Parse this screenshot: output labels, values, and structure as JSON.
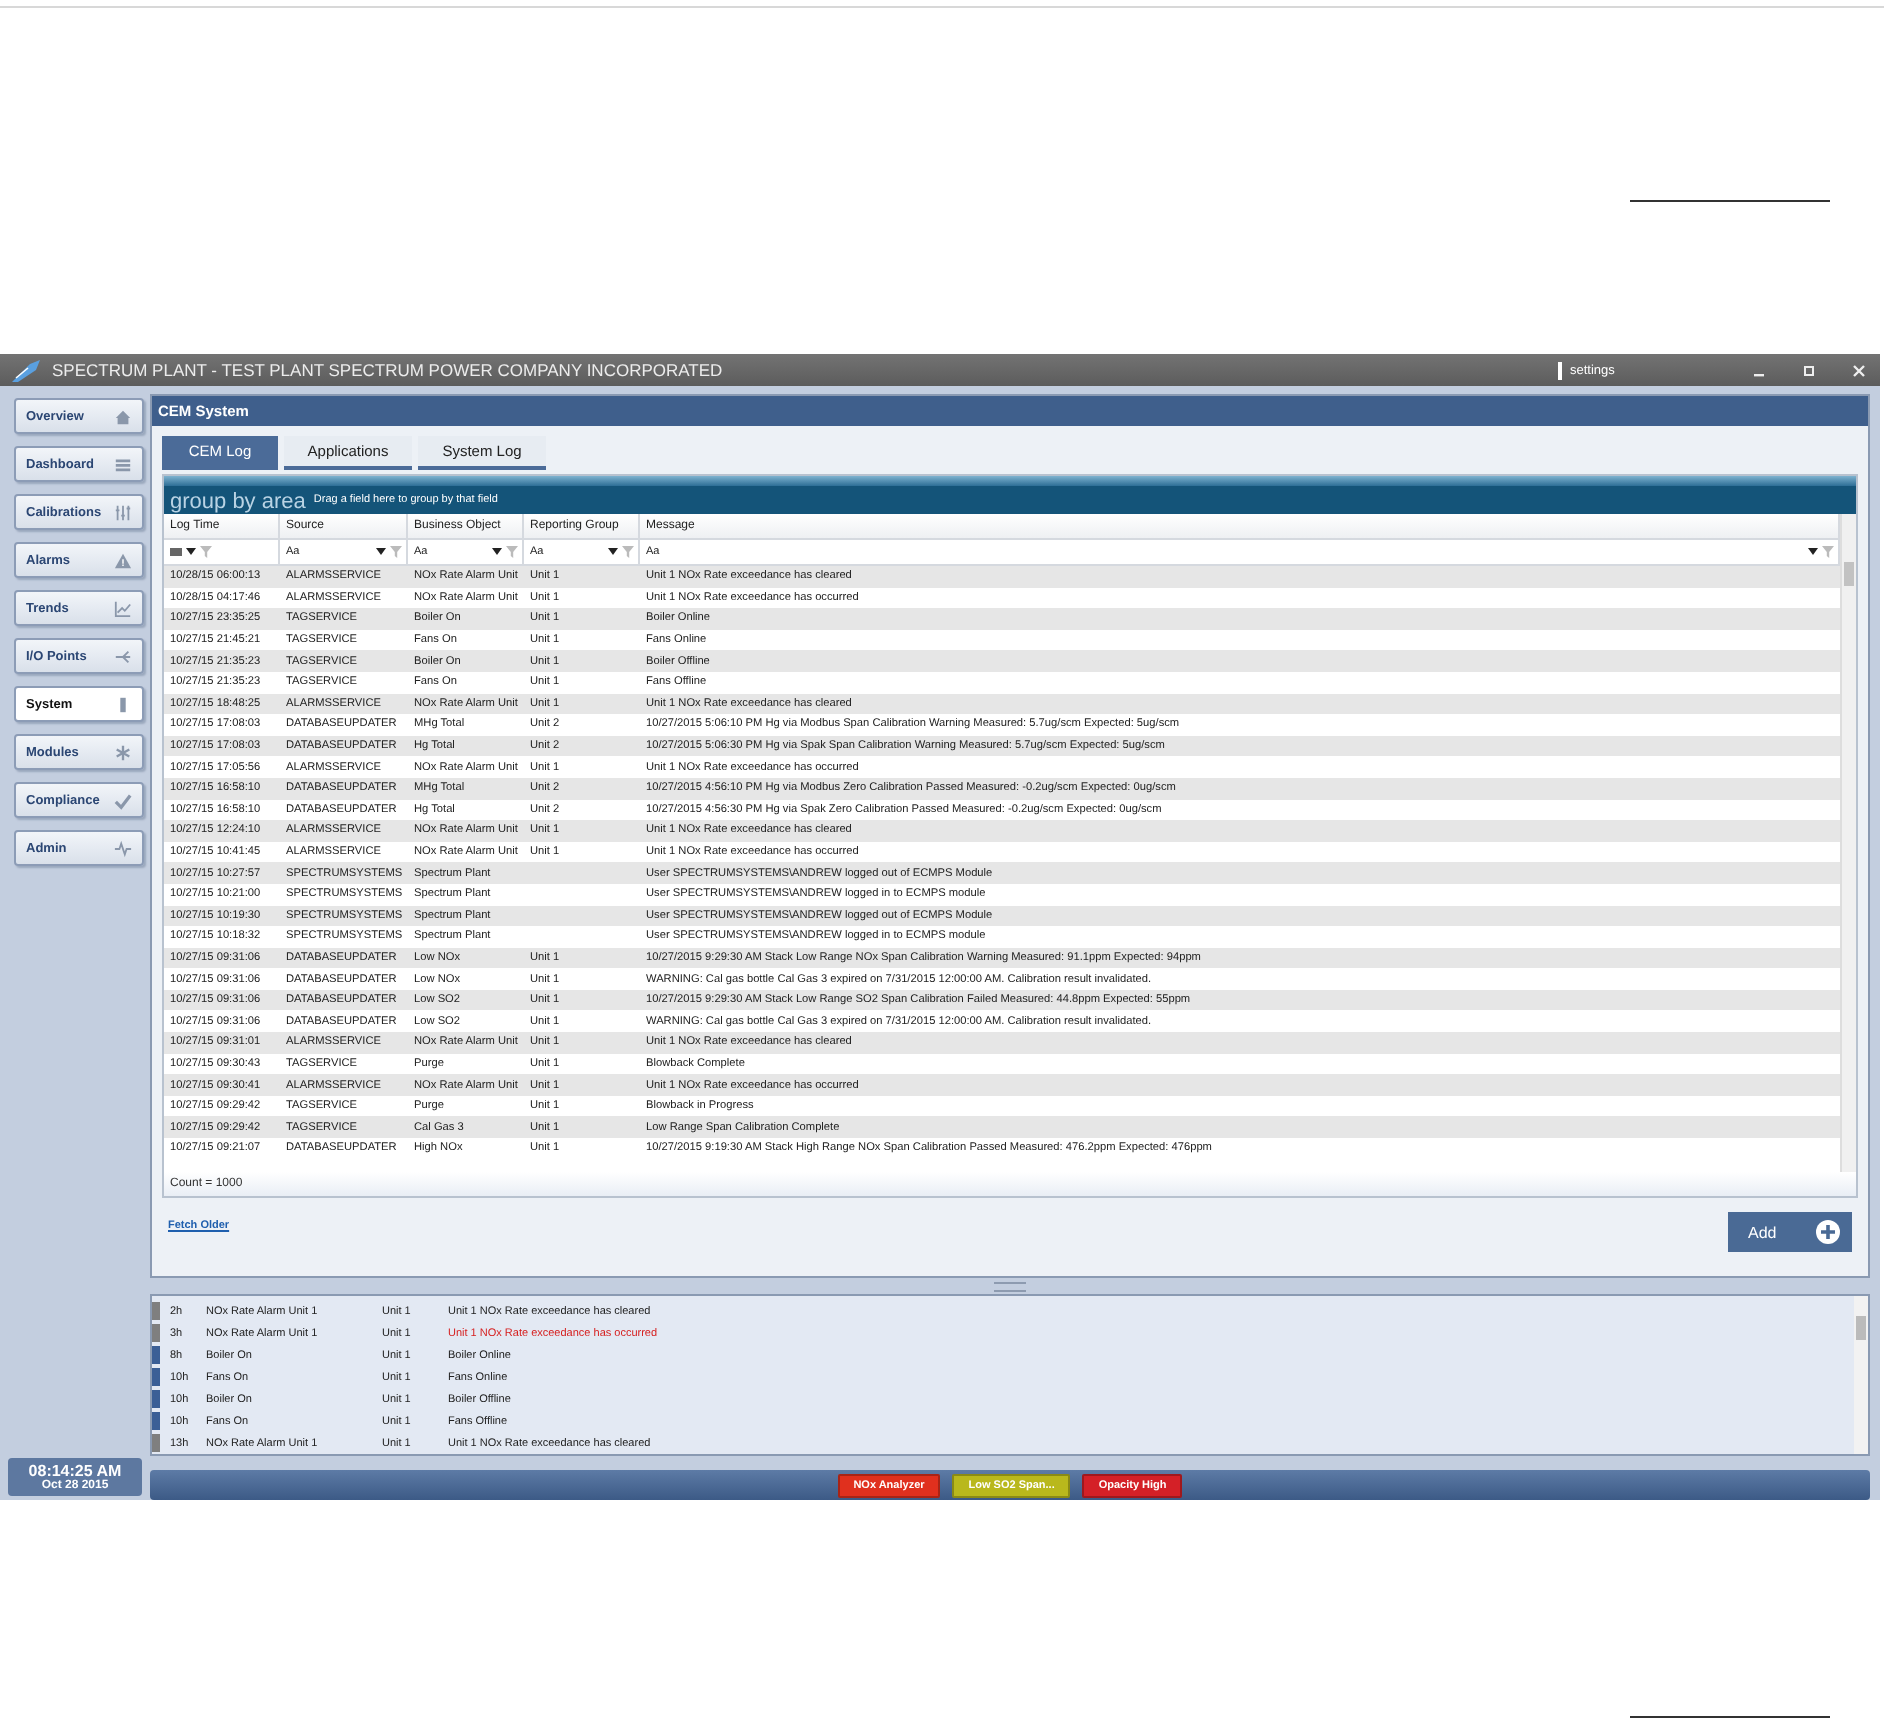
{
  "window": {
    "title": "SPECTRUM PLANT - TEST PLANT SPECTRUM POWER COMPANY INCORPORATED",
    "settings": "settings"
  },
  "sidebar": {
    "items": [
      {
        "label": "Overview",
        "selected": false
      },
      {
        "label": "Dashboard",
        "selected": false
      },
      {
        "label": "Calibrations",
        "selected": false
      },
      {
        "label": "Alarms",
        "selected": false
      },
      {
        "label": "Trends",
        "selected": false
      },
      {
        "label": "I/O Points",
        "selected": false
      },
      {
        "label": "System",
        "selected": true
      },
      {
        "label": "Modules",
        "selected": false
      },
      {
        "label": "Compliance",
        "selected": false
      },
      {
        "label": "Admin",
        "selected": false
      }
    ],
    "clock": {
      "time": "08:14:25 AM",
      "date": "Oct 28 2015"
    }
  },
  "panel": {
    "title": "CEM System",
    "tabs": [
      {
        "label": "CEM Log",
        "selected": true
      },
      {
        "label": "Applications",
        "selected": false
      },
      {
        "label": "System Log",
        "selected": false
      }
    ],
    "group_by": {
      "title": "group by area",
      "hint": "Drag a field here to group by that field"
    },
    "table": {
      "columns": [
        "Log Time",
        "Source",
        "Business Object",
        "Reporting Group",
        "Message"
      ],
      "filters": [
        {
          "kind": "date"
        },
        {
          "kind": "text",
          "value": "Aa"
        },
        {
          "kind": "text",
          "value": "Aa"
        },
        {
          "kind": "text",
          "value": "Aa"
        },
        {
          "kind": "text",
          "value": "Aa"
        }
      ],
      "rows": [
        [
          "10/28/15 06:00:13",
          "ALARMSSERVICE",
          "NOx Rate Alarm Unit",
          "Unit 1",
          "Unit 1 NOx Rate exceedance has cleared"
        ],
        [
          "10/28/15 04:17:46",
          "ALARMSSERVICE",
          "NOx Rate Alarm Unit",
          "Unit 1",
          "Unit 1 NOx Rate exceedance has occurred"
        ],
        [
          "10/27/15 23:35:25",
          "TAGSERVICE",
          "Boiler On",
          "Unit 1",
          "Boiler Online"
        ],
        [
          "10/27/15 21:45:21",
          "TAGSERVICE",
          "Fans On",
          "Unit 1",
          "Fans Online"
        ],
        [
          "10/27/15 21:35:23",
          "TAGSERVICE",
          "Boiler On",
          "Unit 1",
          "Boiler Offline"
        ],
        [
          "10/27/15 21:35:23",
          "TAGSERVICE",
          "Fans On",
          "Unit 1",
          "Fans Offline"
        ],
        [
          "10/27/15 18:48:25",
          "ALARMSSERVICE",
          "NOx Rate Alarm Unit",
          "Unit 1",
          "Unit 1 NOx Rate exceedance has cleared"
        ],
        [
          "10/27/15 17:08:03",
          "DATABASEUPDATER",
          "MHg Total",
          "Unit 2",
          "10/27/2015 5:06:10 PM Hg via Modbus Span Calibration Warning Measured: 5.7ug/scm Expected: 5ug/scm"
        ],
        [
          "10/27/15 17:08:03",
          "DATABASEUPDATER",
          "Hg Total",
          "Unit 2",
          "10/27/2015 5:06:30 PM Hg via Spak Span Calibration Warning Measured: 5.7ug/scm Expected: 5ug/scm"
        ],
        [
          "10/27/15 17:05:56",
          "ALARMSSERVICE",
          "NOx Rate Alarm Unit",
          "Unit 1",
          "Unit 1 NOx Rate exceedance has occurred"
        ],
        [
          "10/27/15 16:58:10",
          "DATABASEUPDATER",
          "MHg Total",
          "Unit 2",
          "10/27/2015 4:56:10 PM Hg via Modbus Zero Calibration Passed Measured: -0.2ug/scm Expected: 0ug/scm"
        ],
        [
          "10/27/15 16:58:10",
          "DATABASEUPDATER",
          "Hg Total",
          "Unit 2",
          "10/27/2015 4:56:30 PM Hg via Spak Zero Calibration Passed Measured: -0.2ug/scm Expected: 0ug/scm"
        ],
        [
          "10/27/15 12:24:10",
          "ALARMSSERVICE",
          "NOx Rate Alarm Unit",
          "Unit 1",
          "Unit 1 NOx Rate exceedance has cleared"
        ],
        [
          "10/27/15 10:41:45",
          "ALARMSSERVICE",
          "NOx Rate Alarm Unit",
          "Unit 1",
          "Unit 1 NOx Rate exceedance has occurred"
        ],
        [
          "10/27/15 10:27:57",
          "SPECTRUMSYSTEMS",
          "Spectrum Plant",
          "",
          "User SPECTRUMSYSTEMS\\ANDREW logged out of ECMPS Module"
        ],
        [
          "10/27/15 10:21:00",
          "SPECTRUMSYSTEMS",
          "Spectrum Plant",
          "",
          "User SPECTRUMSYSTEMS\\ANDREW logged in to ECMPS module"
        ],
        [
          "10/27/15 10:19:30",
          "SPECTRUMSYSTEMS",
          "Spectrum Plant",
          "",
          "User SPECTRUMSYSTEMS\\ANDREW logged out of ECMPS Module"
        ],
        [
          "10/27/15 10:18:32",
          "SPECTRUMSYSTEMS",
          "Spectrum Plant",
          "",
          "User SPECTRUMSYSTEMS\\ANDREW logged in to ECMPS module"
        ],
        [
          "10/27/15 09:31:06",
          "DATABASEUPDATER",
          "Low NOx",
          "Unit 1",
          "10/27/2015 9:29:30 AM Stack Low Range NOx Span Calibration Warning Measured: 91.1ppm Expected: 94ppm"
        ],
        [
          "10/27/15 09:31:06",
          "DATABASEUPDATER",
          "Low NOx",
          "Unit 1",
          "WARNING: Cal gas bottle Cal Gas 3 expired on 7/31/2015 12:00:00 AM. Calibration result invalidated."
        ],
        [
          "10/27/15 09:31:06",
          "DATABASEUPDATER",
          "Low SO2",
          "Unit 1",
          "10/27/2015 9:29:30 AM Stack Low Range SO2 Span Calibration Failed Measured: 44.8ppm Expected: 55ppm"
        ],
        [
          "10/27/15 09:31:06",
          "DATABASEUPDATER",
          "Low SO2",
          "Unit 1",
          "WARNING: Cal gas bottle Cal Gas 3 expired on 7/31/2015 12:00:00 AM. Calibration result invalidated."
        ],
        [
          "10/27/15 09:31:01",
          "ALARMSSERVICE",
          "NOx Rate Alarm Unit",
          "Unit 1",
          "Unit 1 NOx Rate exceedance has cleared"
        ],
        [
          "10/27/15 09:30:43",
          "TAGSERVICE",
          "Purge",
          "Unit 1",
          "Blowback Complete"
        ],
        [
          "10/27/15 09:30:41",
          "ALARMSSERVICE",
          "NOx Rate Alarm Unit",
          "Unit 1",
          "Unit 1 NOx Rate exceedance has occurred"
        ],
        [
          "10/27/15 09:29:42",
          "TAGSERVICE",
          "Purge",
          "Unit 1",
          "Blowback in Progress"
        ],
        [
          "10/27/15 09:29:42",
          "TAGSERVICE",
          "Cal Gas 3",
          "Unit 1",
          "Low Range Span Calibration Complete"
        ],
        [
          "10/27/15 09:21:07",
          "DATABASEUPDATER",
          "High NOx",
          "Unit 1",
          "10/27/2015 9:19:30 AM Stack High Range NOx Span Calibration Passed Measured: 476.2ppm Expected: 476ppm"
        ]
      ],
      "count": "Count = 1000"
    },
    "fetch_link": "Fetch Older",
    "add_button": "Add"
  },
  "alerts": [
    {
      "color": "#7f7f7f",
      "age": "2h",
      "object": "NOx Rate Alarm Unit 1",
      "unit": "Unit 1",
      "message": "Unit 1 NOx Rate exceedance has cleared",
      "active": false
    },
    {
      "color": "#7f7f7f",
      "age": "3h",
      "object": "NOx Rate Alarm Unit 1",
      "unit": "Unit 1",
      "message": "Unit 1 NOx Rate exceedance has occurred",
      "active": true
    },
    {
      "color": "#3b5f96",
      "age": "8h",
      "object": "Boiler On",
      "unit": "Unit 1",
      "message": "Boiler Online",
      "active": false
    },
    {
      "color": "#3b5f96",
      "age": "10h",
      "object": "Fans On",
      "unit": "Unit 1",
      "message": "Fans Online",
      "active": false
    },
    {
      "color": "#3b5f96",
      "age": "10h",
      "object": "Boiler On",
      "unit": "Unit 1",
      "message": "Boiler Offline",
      "active": false
    },
    {
      "color": "#3b5f96",
      "age": "10h",
      "object": "Fans On",
      "unit": "Unit 1",
      "message": "Fans Offline",
      "active": false
    },
    {
      "color": "#7f7f7f",
      "age": "13h",
      "object": "NOx Rate Alarm Unit 1",
      "unit": "Unit 1",
      "message": "Unit 1 NOx Rate exceedance has cleared",
      "active": false
    }
  ],
  "status_bar": {
    "badges": [
      {
        "label": "NOx Analyzer",
        "color": "#e0301e"
      },
      {
        "label": "Low SO2 Span...",
        "color": "#b9b81c"
      },
      {
        "label": "Opacity High",
        "color": "#d42027"
      }
    ]
  }
}
